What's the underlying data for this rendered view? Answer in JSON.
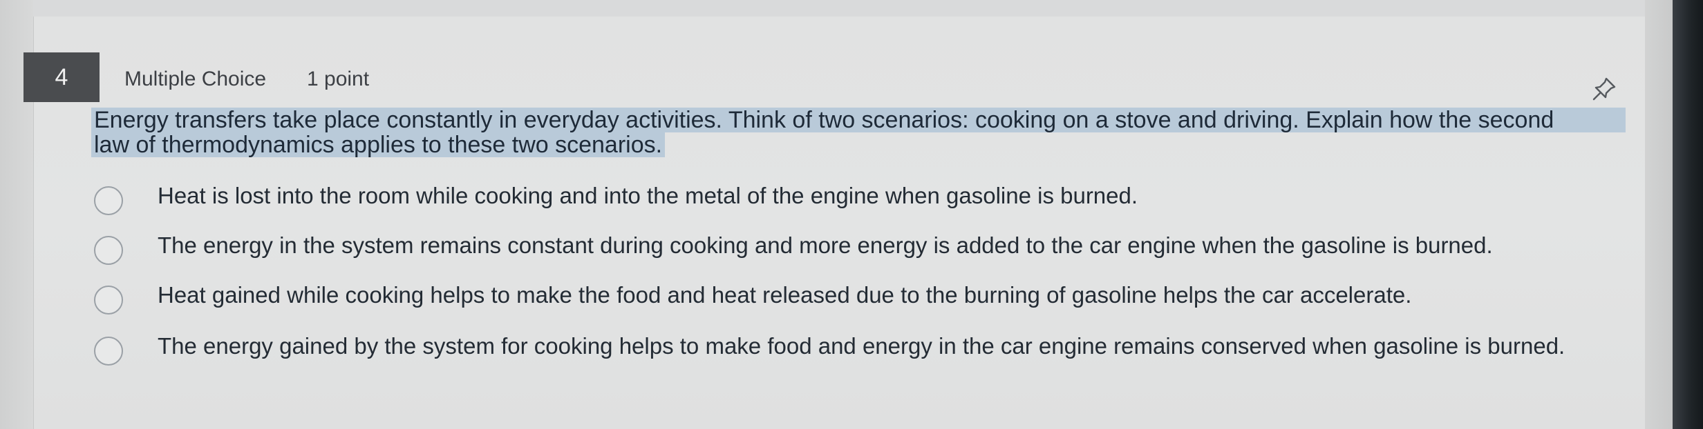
{
  "question": {
    "number": "4",
    "type": "Multiple Choice",
    "points": "1 point",
    "text_line1": "Energy transfers take place constantly in everyday activities. Think of two scenarios: cooking on a stove and driving. Explain how the second",
    "text_line2": "law of thermodynamics applies to these two scenarios."
  },
  "options": [
    {
      "text": "Heat is lost into the room while cooking and into the metal of the engine when gasoline is burned."
    },
    {
      "text": "The energy in the system remains constant during cooking and more energy is added to the car engine when the gasoline is burned."
    },
    {
      "text": "Heat gained while cooking helps to make the food and heat released due to the burning of gasoline helps the car accelerate."
    },
    {
      "text": "The energy gained by the system for cooking helps to make food and energy in the car engine remains conserved when gasoline is burned."
    }
  ],
  "icons": {
    "pin": "pin-icon",
    "radio": "radio-circle"
  },
  "colors": {
    "number_badge": "#4a4c4f",
    "highlight": "#b9cad9",
    "text": "#1e2a38"
  }
}
